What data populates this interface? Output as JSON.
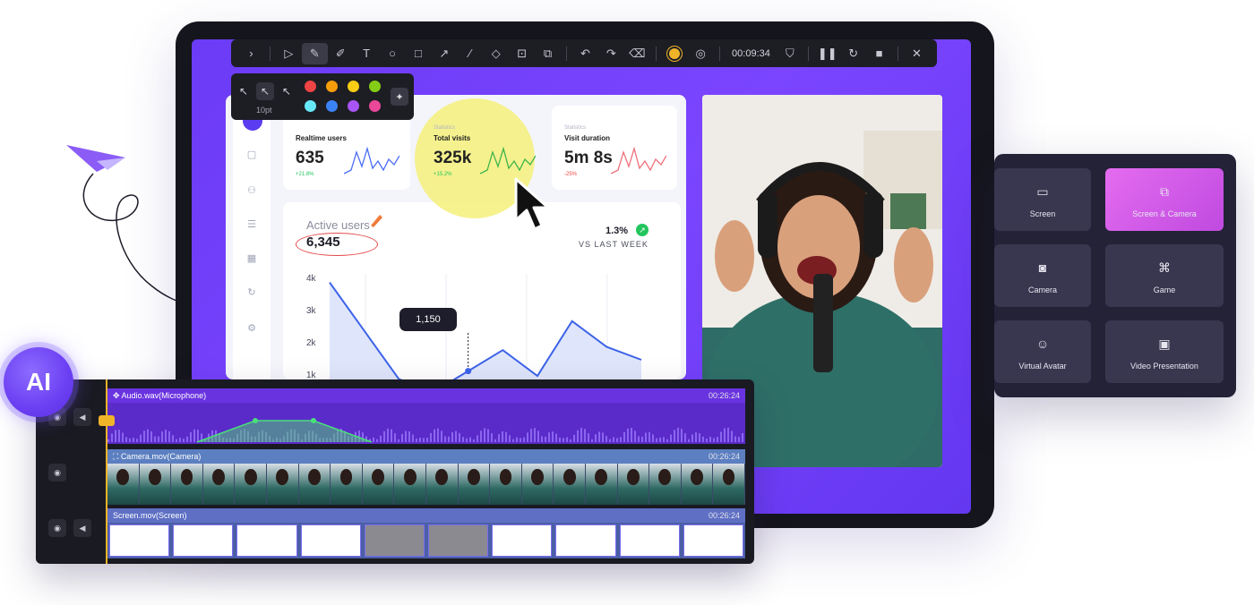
{
  "toolbar": {
    "timer": "00:09:34",
    "tools": [
      "expand",
      "select",
      "pen",
      "highlighter",
      "text",
      "shape-circle",
      "shape-rect",
      "arrow",
      "line",
      "eraser",
      "focus",
      "screenshot",
      "undo",
      "redo",
      "clear",
      "record-indicator",
      "mouse-effect",
      "timer",
      "shield",
      "pause",
      "restart",
      "stop",
      "close"
    ]
  },
  "pen_popover": {
    "size_label": "10pt",
    "colors": [
      "#ef4444",
      "#f59e0b",
      "#facc15",
      "#84cc16",
      "#67e8f9",
      "#3b82f6",
      "#a855f7",
      "#ec4899"
    ]
  },
  "dashboard": {
    "stats": [
      {
        "sublabel": "",
        "label": "Realtime users",
        "value": "635",
        "change": "+21.8%",
        "change_color": "#22c55e",
        "spark_color": "#4a6cf7"
      },
      {
        "sublabel": "Statistics",
        "label": "Total visits",
        "value": "325k",
        "change": "+15.2%",
        "change_color": "#22c55e",
        "spark_color": "#3fb44a"
      },
      {
        "sublabel": "Statistics",
        "label": "Visit duration",
        "value": "5m 8s",
        "change": "-25%",
        "change_color": "#ef4444",
        "spark_color": "#ef6f7a"
      }
    ],
    "active_users": {
      "label": "Active users",
      "value": "6,345",
      "pct": "1.3%",
      "vs": "VS LAST WEEK",
      "tooltip": "1,150"
    },
    "y_ticks": [
      "4k",
      "3k",
      "2k",
      "1k"
    ]
  },
  "chart_data": {
    "type": "area",
    "title": "",
    "ylabel": "",
    "ylim": [
      0,
      4000
    ],
    "x": [
      0,
      1,
      2,
      3,
      4,
      5,
      6,
      7,
      8,
      9
    ],
    "values": [
      3900,
      2400,
      900,
      500,
      1150,
      1800,
      1000,
      2700,
      1900,
      1500
    ]
  },
  "modes": [
    {
      "label": "Screen",
      "icon": "screen-icon",
      "selected": false
    },
    {
      "label": "Screen & Camera",
      "icon": "screen-camera-icon",
      "selected": true
    },
    {
      "label": "Camera",
      "icon": "camera-icon",
      "selected": false
    },
    {
      "label": "Game",
      "icon": "gamepad-icon",
      "selected": false
    },
    {
      "label": "Virtual Avatar",
      "icon": "avatar-icon",
      "selected": false
    },
    {
      "label": "Video Presentation",
      "icon": "presentation-icon",
      "selected": false
    }
  ],
  "timeline": {
    "tracks": [
      {
        "name": "Audio.wav(Microphone)",
        "duration": "00:26:24"
      },
      {
        "name": "Camera.mov(Camera)",
        "duration": "00:26:24"
      },
      {
        "name": "Screen.mov(Screen)",
        "duration": "00:26:24"
      }
    ]
  },
  "ai_badge": "AI"
}
